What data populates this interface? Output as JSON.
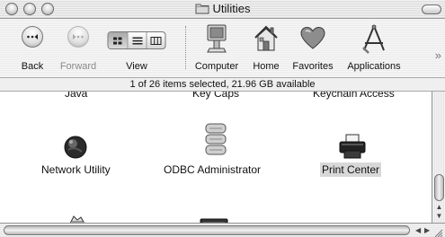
{
  "window": {
    "title": "Utilities"
  },
  "toolbar": {
    "back_label": "Back",
    "forward_label": "Forward",
    "view_label": "View",
    "computer_label": "Computer",
    "home_label": "Home",
    "favorites_label": "Favorites",
    "applications_label": "Applications",
    "overflow_glyph": "»"
  },
  "status": {
    "text": "1 of 26 items selected, 21.96 GB available"
  },
  "content": {
    "partial_labels": [
      "Java",
      "Key Caps",
      "Keychain Access"
    ],
    "items": [
      {
        "label": "Network Utility",
        "icon": "network-globe-icon"
      },
      {
        "label": "ODBC Administrator",
        "icon": "database-icon"
      },
      {
        "label": "Print Center",
        "icon": "printer-icon",
        "selected": true
      }
    ],
    "partial_icons": [
      "script-icon",
      "terminal-icon"
    ]
  }
}
